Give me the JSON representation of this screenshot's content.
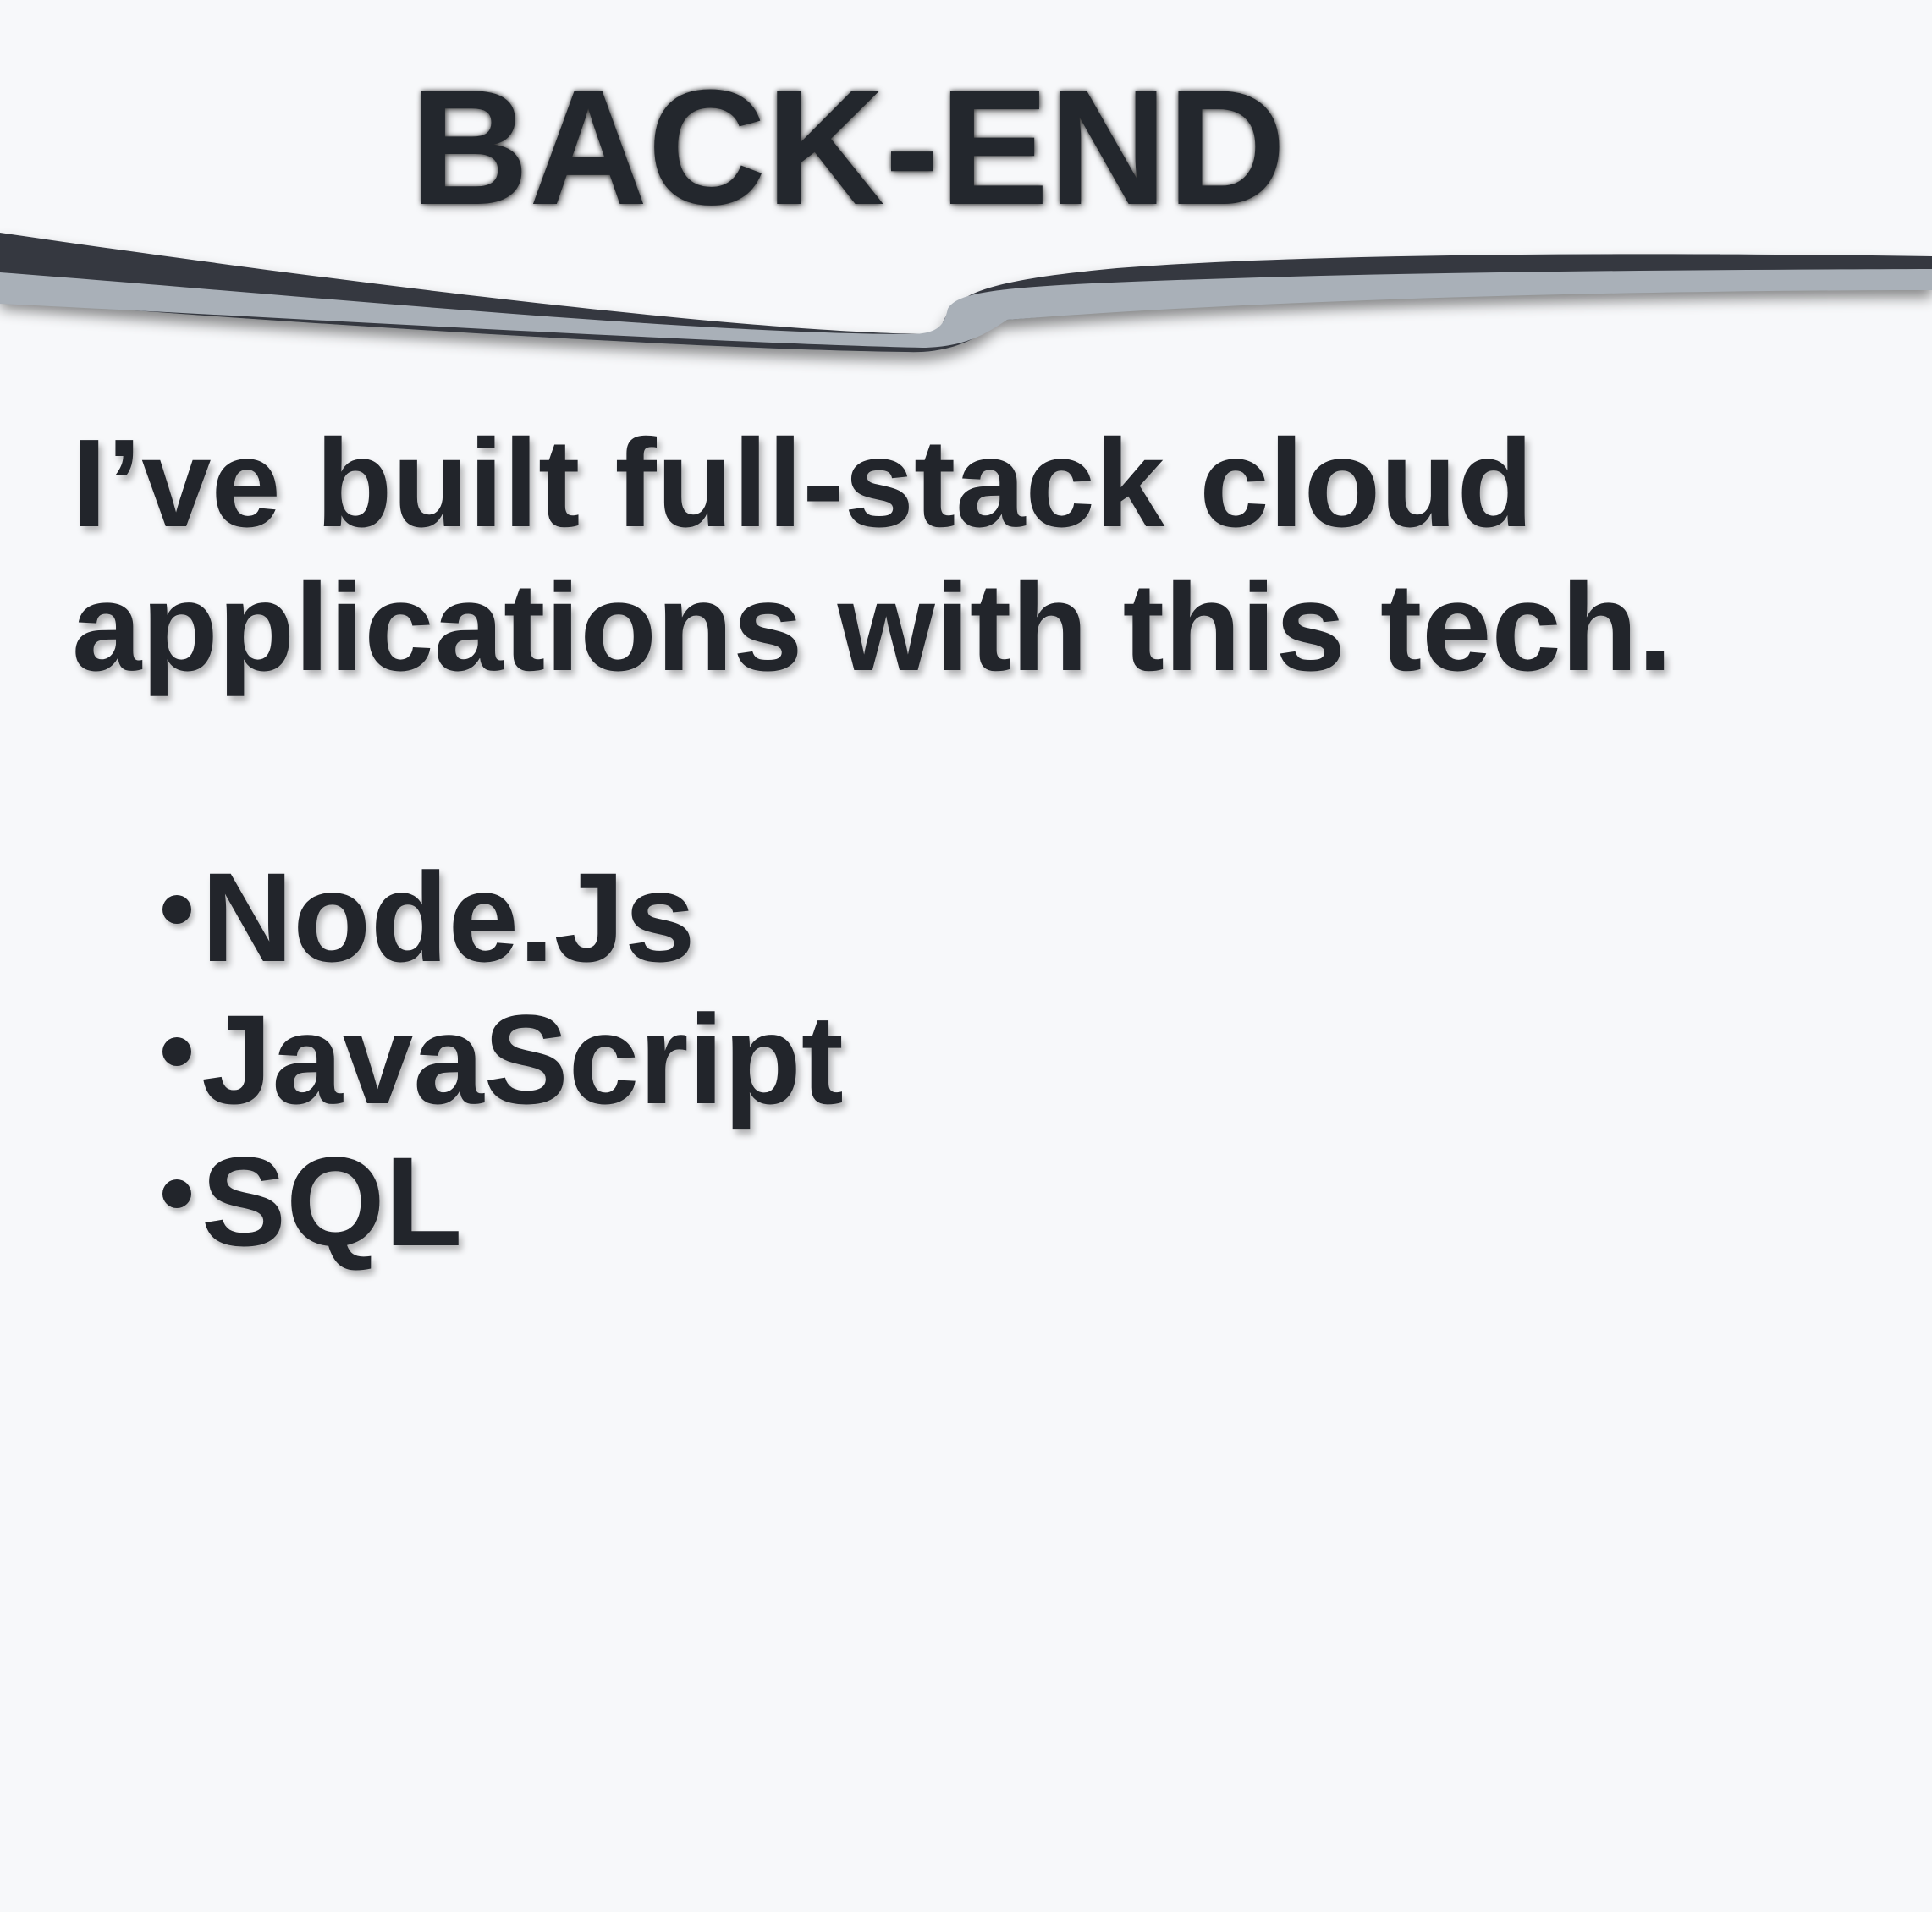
{
  "slide": {
    "title": "BACK-END",
    "description_lines": [
      "I’ve built full-stack cloud",
      "applications with this tech."
    ],
    "bullets": [
      "Node.Js",
      "JavaScript",
      "SQL"
    ]
  },
  "colors": {
    "background": "#f7f8fa",
    "text": "#22252b",
    "divider_dark": "#343841",
    "divider_light": "#a9b0b8"
  }
}
